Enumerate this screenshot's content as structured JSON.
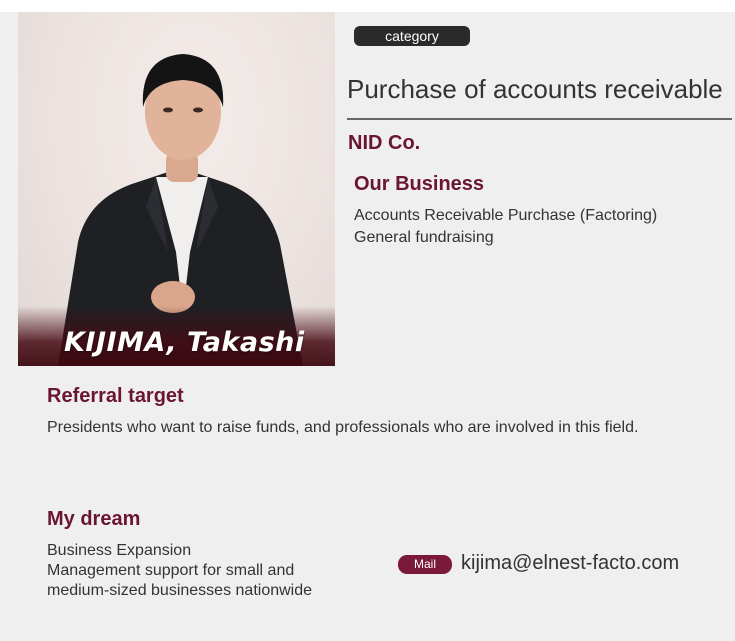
{
  "profile": {
    "name": "KIJIMA, Takashi",
    "category_label": "category",
    "category": "Purchase of accounts receivable",
    "company": "NID Co."
  },
  "business": {
    "heading": "Our Business",
    "lines": [
      "Accounts Receivable Purchase (Factoring)",
      "General fundraising"
    ]
  },
  "referral": {
    "heading": "Referral target",
    "text": "Presidents who want to raise funds, and professionals who are involved in this field."
  },
  "dream": {
    "heading": "My dream",
    "lines": [
      "Business Expansion",
      "Management support for small and",
      "medium-sized businesses nationwide"
    ]
  },
  "contact": {
    "mail_label": "Mail",
    "email": "kijima@elnest-facto.com"
  },
  "colors": {
    "accent": "#6b1630",
    "badge": "#7a1a38",
    "pill": "#2a2a2a",
    "background": "#efefef"
  }
}
